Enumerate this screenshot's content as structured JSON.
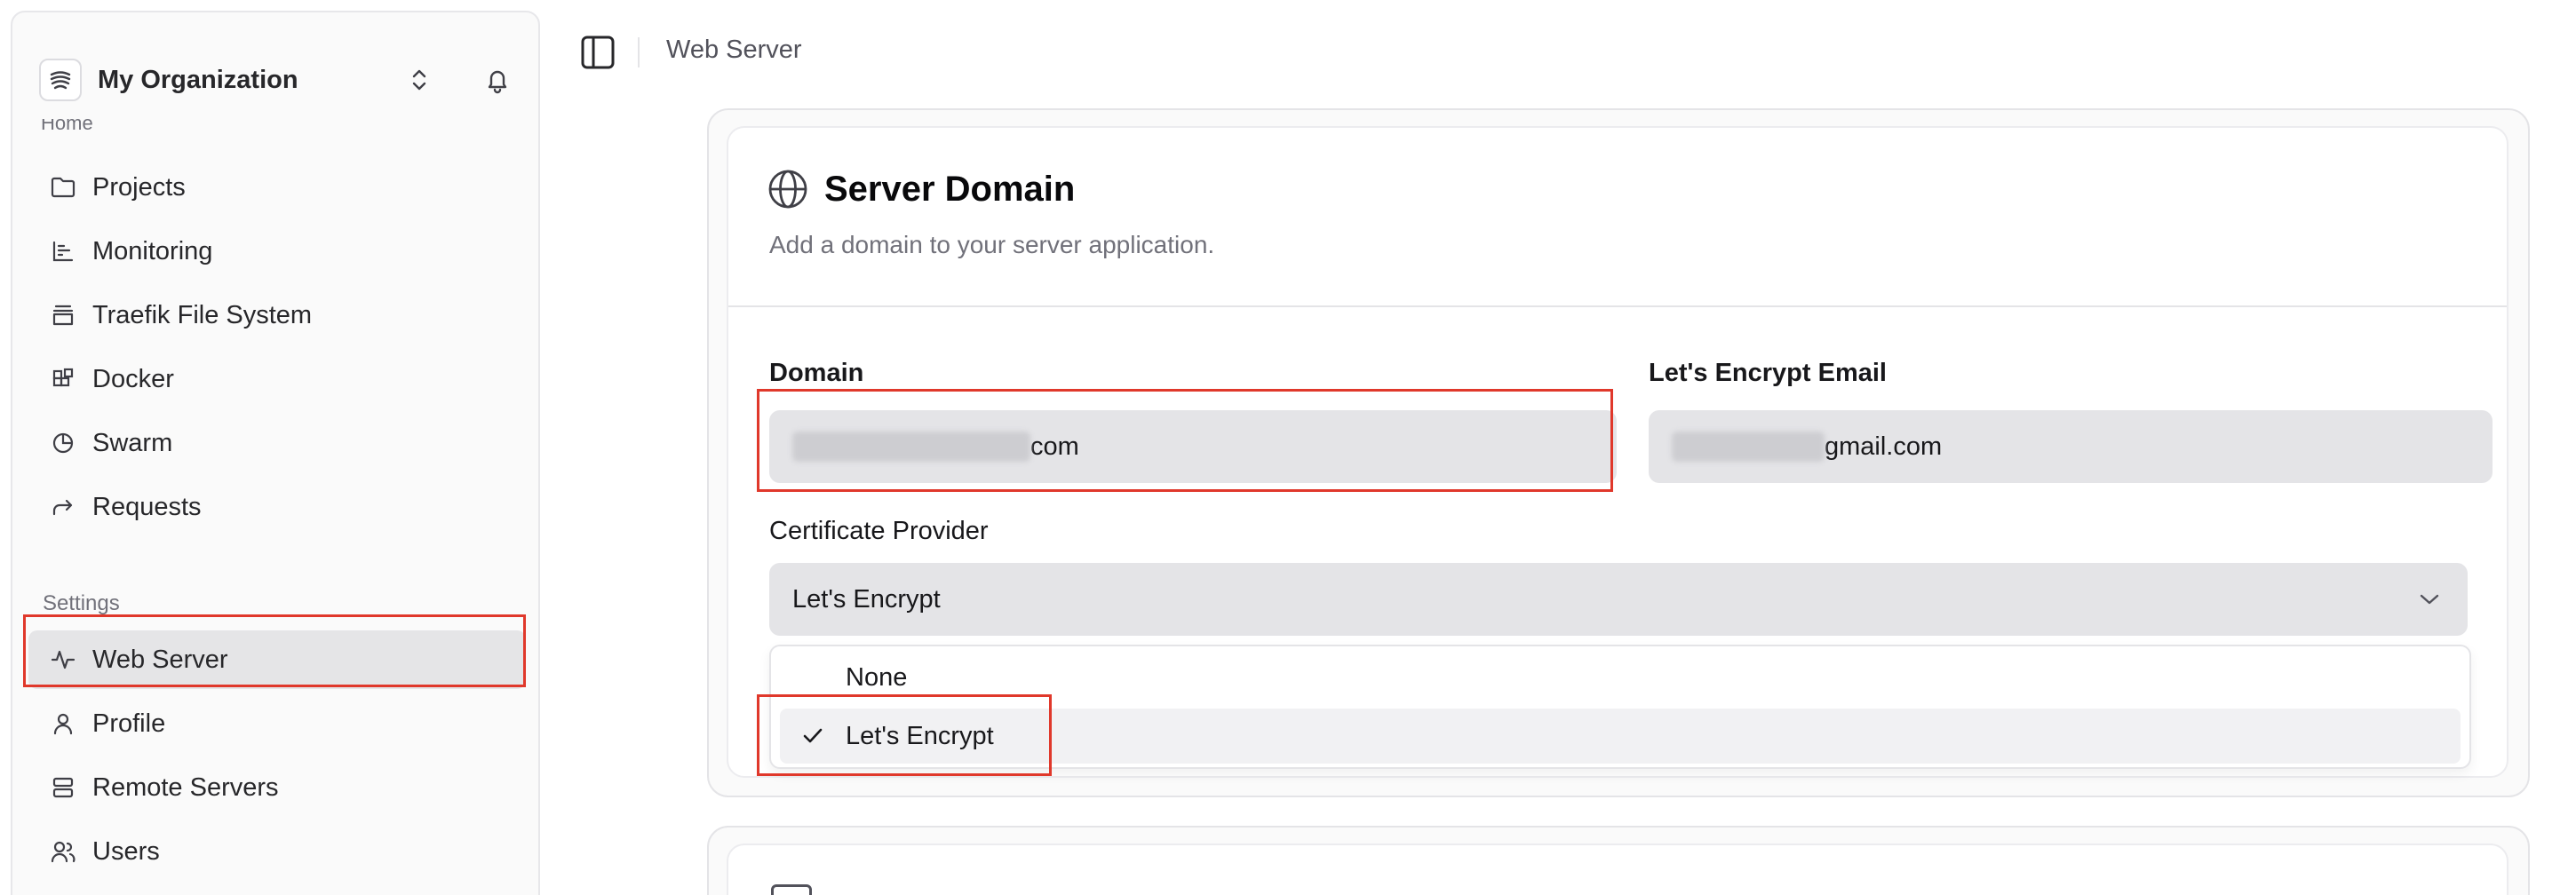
{
  "sidebar": {
    "org_name": "My Organization",
    "cut_label": "Home",
    "section_label": "Settings",
    "items": [
      {
        "label": "Projects",
        "icon": "folder-icon"
      },
      {
        "label": "Monitoring",
        "icon": "chart-icon"
      },
      {
        "label": "Traefik File System",
        "icon": "stack-icon"
      },
      {
        "label": "Docker",
        "icon": "blocks-icon"
      },
      {
        "label": "Swarm",
        "icon": "pie-icon"
      },
      {
        "label": "Requests",
        "icon": "forward-icon"
      }
    ],
    "settings_items": [
      {
        "label": "Web Server",
        "icon": "activity-icon",
        "active": true
      },
      {
        "label": "Profile",
        "icon": "user-icon"
      },
      {
        "label": "Remote Servers",
        "icon": "server-icon"
      },
      {
        "label": "Users",
        "icon": "users-icon"
      }
    ]
  },
  "header": {
    "breadcrumb": "Web Server"
  },
  "card": {
    "title": "Server Domain",
    "description": "Add a domain to your server application.",
    "domain_label": "Domain",
    "domain_value_visible": "com",
    "email_label": "Let's Encrypt Email",
    "email_value_visible": "gmail.com",
    "cert_label": "Certificate Provider",
    "cert_value": "Let's Encrypt",
    "options": [
      {
        "label": "None",
        "selected": false
      },
      {
        "label": "Let's Encrypt",
        "selected": true
      }
    ]
  },
  "colors": {
    "highlight": "#e0382b",
    "active_bg": "#e5e5e7",
    "input_bg": "#e4e4e7"
  }
}
